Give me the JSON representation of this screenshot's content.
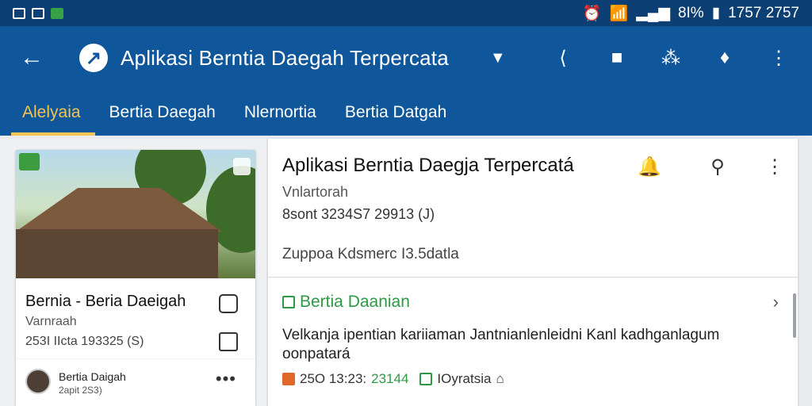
{
  "status_bar": {
    "battery": "8I%",
    "time": "1757 2757"
  },
  "app_bar": {
    "title": "Aplikasi Berntia Daegah Terpercata"
  },
  "tabs": [
    {
      "label": "Alelyaia",
      "active": true
    },
    {
      "label": "Bertia Daegah",
      "active": false
    },
    {
      "label": "Nlernortia",
      "active": false
    },
    {
      "label": "Bertia Datgah",
      "active": false
    }
  ],
  "left_card": {
    "title": "Bernia - Beria Daeigah",
    "subtitle": "Varnraah",
    "meta": "253I IIcta 193325 (S)"
  },
  "left_card2": {
    "name": "Bertia Daigah",
    "time": "2apit 2S3)"
  },
  "main": {
    "title": "Aplikasi Berntia Daegja Terpercatá",
    "subtitle": "Vnlartorah",
    "meta": "8sont 3234S7 29913 (J)",
    "zone": "Zuppoa Kdsmerc I3.5datla",
    "section": "Bertia Daanian",
    "body": "Velkanja ipentian kariiaman Jantnianlenleidni Kanl kadhganlagum oonpatará",
    "foot_time": "25O 13:23:",
    "foot_green": "23144",
    "foot_tag": "IOyratsia"
  },
  "colors": {
    "primary": "#0f579a",
    "status_bar": "#0c3f73",
    "accent_tab": "#f3c354",
    "green": "#2c9a45",
    "orange": "#e0682b"
  }
}
